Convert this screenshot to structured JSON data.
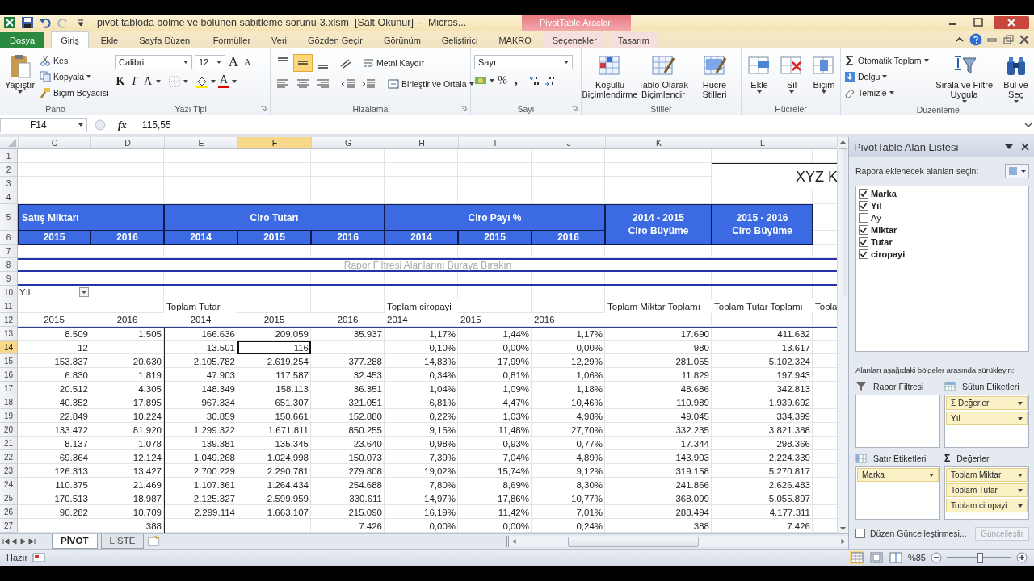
{
  "title_bar": {
    "title": "pivot tabloda bölme ve bölünen sabitleme sorunu-3.xlsm  [Salt Okunur]  -  Micros...",
    "tool_group": "PivotTable Araçları"
  },
  "menu_tabs": [
    {
      "label": "Dosya",
      "kind": "file",
      "selected": false
    },
    {
      "label": "Giriş",
      "kind": "normal",
      "selected": true
    },
    {
      "label": "Ekle",
      "kind": "normal",
      "selected": false
    },
    {
      "label": "Sayfa Düzeni",
      "kind": "normal",
      "selected": false
    },
    {
      "label": "Formüller",
      "kind": "normal",
      "selected": false
    },
    {
      "label": "Veri",
      "kind": "normal",
      "selected": false
    },
    {
      "label": "Gözden Geçir",
      "kind": "normal",
      "selected": false
    },
    {
      "label": "Görünüm",
      "kind": "normal",
      "selected": false
    },
    {
      "label": "Geliştirici",
      "kind": "normal",
      "selected": false
    },
    {
      "label": "MAKRO",
      "kind": "normal",
      "selected": false
    },
    {
      "label": "Seçenekler",
      "kind": "contextual",
      "selected": false
    },
    {
      "label": "Tasarım",
      "kind": "contextual",
      "selected": false
    }
  ],
  "ribbon": {
    "clipboard": {
      "label": "Pano",
      "paste": "Yapıştır",
      "cut": "Kes",
      "copy": "Kopyala",
      "format_painter": "Biçim Boyacısı"
    },
    "font": {
      "label": "Yazı Tipi",
      "font_name": "Calibri",
      "font_size": "12",
      "grow": "A",
      "shrink": "A",
      "bold": "K",
      "italic": "T",
      "underline": "A",
      "font_color": "A"
    },
    "alignment": {
      "label": "Hizalama",
      "vertical": [
        {
          "selected": false
        },
        {
          "selected": true
        },
        {
          "selected": false
        }
      ],
      "wrap_text": "Metni Kaydır",
      "merge_center": "Birleştir ve Ortala"
    },
    "number": {
      "label": "Sayı",
      "format": "Sayı",
      "percent": "%",
      "thousands": ","
    },
    "styles": {
      "label": "Stiller",
      "buttons": [
        "Koşullu\nBiçimlendirme",
        "Tablo Olarak\nBiçimlendir",
        "Hücre\nStilleri"
      ]
    },
    "cells": {
      "label": "Hücreler",
      "buttons": [
        "Ekle",
        "Sil",
        "Biçim"
      ]
    },
    "editing": {
      "label": "Düzenleme",
      "autosum": "Otomatik Toplam",
      "fill": "Dolgu",
      "clear": "Temizle",
      "sort_filter": "Sırala ve Filtre\nUygula",
      "find_select": "Bul ve\nSeç"
    }
  },
  "formula_bar": {
    "name_box": "F14",
    "function_label": "fx",
    "formula": "115,55"
  },
  "sheet": {
    "columns": [
      {
        "label": "C",
        "selected": false
      },
      {
        "label": "D",
        "selected": false
      },
      {
        "label": "E",
        "selected": false
      },
      {
        "label": "F",
        "selected": true
      },
      {
        "label": "G",
        "selected": false
      },
      {
        "label": "H",
        "selected": false
      },
      {
        "label": "I",
        "selected": false
      },
      {
        "label": "J",
        "selected": false
      },
      {
        "label": "K",
        "selected": false
      },
      {
        "label": "L",
        "selected": false
      }
    ],
    "rows": [
      {
        "label": "1",
        "selected": false
      },
      {
        "label": "2",
        "selected": false
      },
      {
        "label": "3",
        "selected": false
      },
      {
        "label": "4",
        "selected": false
      },
      {
        "label": "5",
        "selected": false
      },
      {
        "label": "6",
        "selected": false
      },
      {
        "label": "7",
        "selected": false
      },
      {
        "label": "8",
        "selected": false
      },
      {
        "label": "9",
        "selected": false
      },
      {
        "label": "10",
        "selected": false
      },
      {
        "label": "11",
        "selected": false
      },
      {
        "label": "12",
        "selected": false
      },
      {
        "label": "13",
        "selected": false
      },
      {
        "label": "14",
        "selected": true
      },
      {
        "label": "15",
        "selected": false
      },
      {
        "label": "16",
        "selected": false
      },
      {
        "label": "17",
        "selected": false
      },
      {
        "label": "18",
        "selected": false
      },
      {
        "label": "19",
        "selected": false
      },
      {
        "label": "20",
        "selected": false
      },
      {
        "label": "21",
        "selected": false
      },
      {
        "label": "22",
        "selected": false
      },
      {
        "label": "23",
        "selected": false
      },
      {
        "label": "24",
        "selected": false
      },
      {
        "label": "25",
        "selected": false
      },
      {
        "label": "26",
        "selected": false
      },
      {
        "label": "27",
        "selected": false
      }
    ],
    "title_box": "XYZ K",
    "band_header": [
      {
        "label": "Satış Miktarı",
        "years": [
          "2015",
          "2016"
        ]
      },
      {
        "label": "Ciro Tutarı",
        "years": [
          "2014",
          "2015",
          "2016"
        ]
      },
      {
        "label": "Ciro Payı %",
        "years": [
          "2014",
          "2015",
          "2016"
        ]
      },
      {
        "label": "2014 - 2015\nCiro Büyüme"
      },
      {
        "label": "2015 - 2016\nCiro Büyüme"
      }
    ],
    "filter_drop_zone": "Rapor Filtresi Alanlarını Buraya Bırakın",
    "page_filter": "Yıl"
  },
  "pivot": {
    "header_row": {
      "e": "Toplam Tutar",
      "h": "Toplam ciropayi",
      "k": "Toplam Miktar Toplamı",
      "l": "Toplam Tutar Toplamı",
      "m": "Topla"
    },
    "year_row": [
      "2015",
      "2016",
      "2014",
      "2015",
      "2016",
      "2014",
      "2015",
      "2016"
    ],
    "rows": [
      {
        "c": "8.509",
        "d": "1.505",
        "e": "166.636",
        "f": "209.059",
        "g": "35.937",
        "h": "1,17%",
        "i": "1,44%",
        "j": "1,17%",
        "k": "17.690",
        "l": "411.632"
      },
      {
        "c": "12",
        "e": "13.501",
        "f": "116",
        "h": "0,10%",
        "i": "0,00%",
        "j": "0,00%",
        "k": "980",
        "l": "13.617"
      },
      {
        "c": "153.837",
        "d": "20.630",
        "e": "2.105.782",
        "f": "2.619.254",
        "g": "377.288",
        "h": "14,83%",
        "i": "17,99%",
        "j": "12,29%",
        "k": "281.055",
        "l": "5.102.324"
      },
      {
        "c": "6.830",
        "d": "1.819",
        "e": "47.903",
        "f": "117.587",
        "g": "32.453",
        "h": "0,34%",
        "i": "0,81%",
        "j": "1,06%",
        "k": "11.829",
        "l": "197.943"
      },
      {
        "c": "20.512",
        "d": "4.305",
        "e": "148.349",
        "f": "158.113",
        "g": "36.351",
        "h": "1,04%",
        "i": "1,09%",
        "j": "1,18%",
        "k": "48.686",
        "l": "342.813"
      },
      {
        "c": "40.352",
        "d": "17.895",
        "e": "967.334",
        "f": "651.307",
        "g": "321.051",
        "h": "6,81%",
        "i": "4,47%",
        "j": "10,46%",
        "k": "110.989",
        "l": "1.939.692"
      },
      {
        "c": "22.849",
        "d": "10.224",
        "e": "30.859",
        "f": "150.661",
        "g": "152.880",
        "h": "0,22%",
        "i": "1,03%",
        "j": "4,98%",
        "k": "49.045",
        "l": "334.399"
      },
      {
        "c": "133.472",
        "d": "81.920",
        "e": "1.299.322",
        "f": "1.671.811",
        "g": "850.255",
        "h": "9,15%",
        "i": "11,48%",
        "j": "27,70%",
        "k": "332.235",
        "l": "3.821.388"
      },
      {
        "c": "8.137",
        "d": "1.078",
        "e": "139.381",
        "f": "135.345",
        "g": "23.640",
        "h": "0,98%",
        "i": "0,93%",
        "j": "0,77%",
        "k": "17.344",
        "l": "298.366"
      },
      {
        "c": "69.364",
        "d": "12.124",
        "e": "1.049.268",
        "f": "1.024.998",
        "g": "150.073",
        "h": "7,39%",
        "i": "7,04%",
        "j": "4,89%",
        "k": "143.903",
        "l": "2.224.339"
      },
      {
        "c": "126.313",
        "d": "13.427",
        "e": "2.700.229",
        "f": "2.290.781",
        "g": "279.808",
        "h": "19,02%",
        "i": "15,74%",
        "j": "9,12%",
        "k": "319.158",
        "l": "5.270.817"
      },
      {
        "c": "110.375",
        "d": "21.469",
        "e": "1.107.361",
        "f": "1.264.434",
        "g": "254.688",
        "h": "7,80%",
        "i": "8,69%",
        "j": "8,30%",
        "k": "241.866",
        "l": "2.626.483"
      },
      {
        "c": "170.513",
        "d": "18.987",
        "e": "2.125.327",
        "f": "2.599.959",
        "g": "330.611",
        "h": "14,97%",
        "i": "17,86%",
        "j": "10,77%",
        "k": "368.099",
        "l": "5.055.897"
      },
      {
        "c": "90.282",
        "d": "10.709",
        "e": "2.299.114",
        "f": "1.663.107",
        "g": "215.090",
        "h": "16,19%",
        "i": "11,42%",
        "j": "7,01%",
        "k": "288.494",
        "l": "4.177.311"
      },
      {
        "d": "388",
        "g": "7.426",
        "h": "0,00%",
        "i": "0,00%",
        "j": "0,24%",
        "k": "388",
        "l": "7.426"
      }
    ]
  },
  "field_list": {
    "title": "PivotTable Alan Listesi",
    "prompt": "Rapora eklenecek alanları seçin:",
    "fields": [
      {
        "label": "Marka",
        "checked": true
      },
      {
        "label": "Yıl",
        "checked": true
      },
      {
        "label": "Ay",
        "checked": false
      },
      {
        "label": "Miktar",
        "checked": true
      },
      {
        "label": "Tutar",
        "checked": true
      },
      {
        "label": "ciropayi",
        "checked": true
      }
    ],
    "drag_prompt": "Alanları aşağıdaki bölgeler arasında sürükleyin:",
    "areas": [
      {
        "kind": "filter",
        "label": "Rapor Filtresi"
      },
      {
        "kind": "columns",
        "label": "Sütun Etiketleri",
        "items": [
          "Σ Değerler",
          "Yıl"
        ]
      },
      {
        "kind": "rows",
        "label": "Satır Etiketleri",
        "items": [
          "Marka"
        ]
      },
      {
        "kind": "values",
        "icon": "Σ",
        "label": "Değerler",
        "items": [
          "Toplam Miktar",
          "Toplam Tutar",
          "Toplam ciropayi"
        ]
      }
    ],
    "defer_update": {
      "label": "Düzen Güncelleştirmesi...",
      "checked": false
    },
    "update_button": {
      "label": "Güncelleştir",
      "disabled": true
    }
  },
  "sheet_tabs": [
    {
      "label": "PİVOT",
      "selected": true
    },
    {
      "label": "LİSTE",
      "selected": false
    }
  ],
  "status_bar": {
    "ready": "Hazır",
    "zoom": "%85",
    "zoom_slider": {
      "level": 0.5
    }
  }
}
